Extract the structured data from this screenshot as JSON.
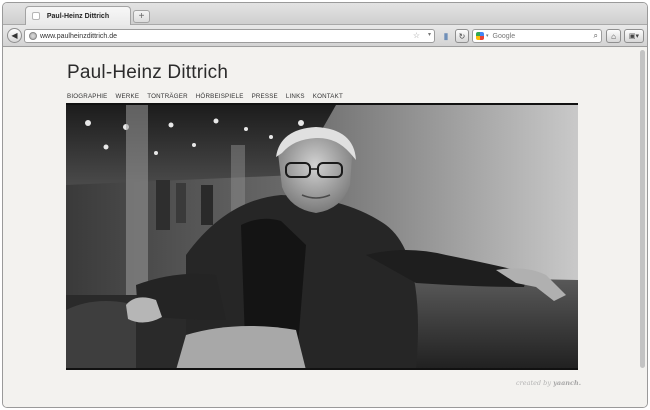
{
  "browser": {
    "tab_title": "Paul-Heinz Dittrich",
    "new_tab_symbol": "+",
    "url": "www.paulheinzdittrich.de",
    "search_placeholder": "Google"
  },
  "site": {
    "title": "Paul-Heinz Dittrich",
    "nav": [
      "BIOGRAPHIE",
      "WERKE",
      "TONTRÄGER",
      "HÖRBEISPIELE",
      "PRESSE",
      "LINKS",
      "KONTAKT"
    ],
    "credit_prefix": "created by",
    "credit_name": "yaanch."
  },
  "icons": {
    "back": "back-arrow-icon",
    "reload": "reload-icon",
    "home": "home-icon",
    "bookmark": "star-icon",
    "search": "magnifier-icon"
  }
}
